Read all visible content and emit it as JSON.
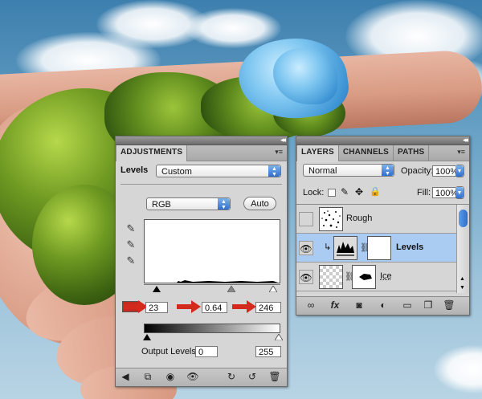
{
  "adjustments": {
    "tab": "ADJUSTMENTS",
    "levels_label": "Levels",
    "preset": "Custom",
    "channel": "RGB",
    "auto_label": "Auto",
    "input_black": "23",
    "input_gamma": "0.64",
    "input_white": "246",
    "output_label": "Output Levels:",
    "output_black": "0",
    "output_white": "255"
  },
  "layers_panel": {
    "tabs": [
      "LAYERS",
      "CHANNELS",
      "PATHS"
    ],
    "blend_mode": "Normal",
    "opacity_label": "Opacity:",
    "opacity": "100%",
    "lock_label": "Lock:",
    "fill_label": "Fill:",
    "fill": "100%",
    "layers": [
      {
        "name": "Rough",
        "visible": false,
        "selected": false
      },
      {
        "name": "Levels",
        "visible": true,
        "selected": true
      },
      {
        "name": "Ice",
        "visible": true,
        "selected": false
      }
    ]
  },
  "colors": {
    "selection": "#aacbf2",
    "accent_blue": "#2f6fce",
    "arrow_red": "#d42a1e",
    "panel": "#d6d6d6"
  }
}
